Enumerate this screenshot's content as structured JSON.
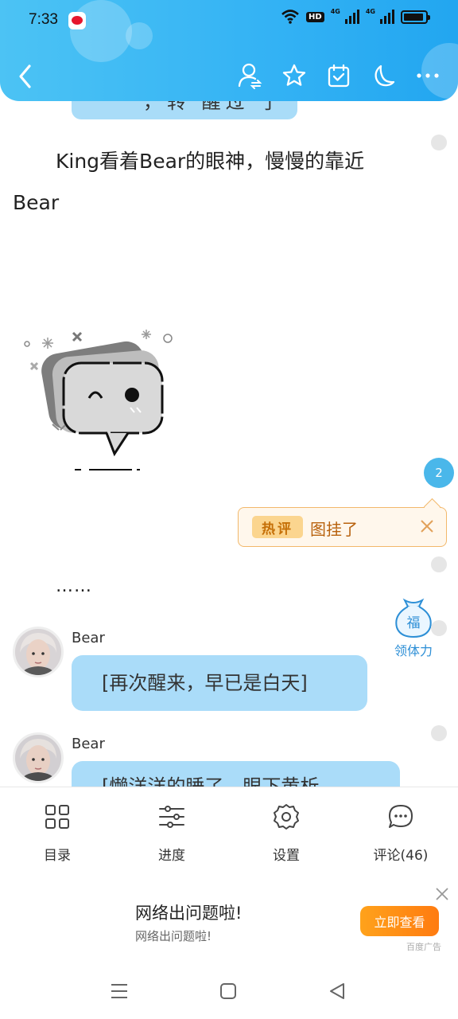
{
  "status_bar": {
    "time": "7:33",
    "hd_badge": "HD",
    "net_1": "4G",
    "net_2": "4G"
  },
  "header": {
    "icons": [
      "back-icon",
      "user-switch-icon",
      "star-icon",
      "calendar-check-icon",
      "moon-icon",
      "more-icon"
    ]
  },
  "content": {
    "top_bubble_fragment": "，转 醒过 了",
    "paragraph_1": "King看着Bear的眼神，慢慢的靠近Bear",
    "ellipsis": "……",
    "comment_badge": "2",
    "hot_comment": {
      "label": "热评",
      "text": "图挂了"
    },
    "fu": {
      "char": "福",
      "label": "领体力"
    },
    "messages": [
      {
        "speaker": "Bear",
        "text": "[再次醒来，早已是白天]"
      },
      {
        "speaker": "Bear",
        "text": "[懒洋洋的睡了，眼下黄析"
      }
    ]
  },
  "toolbar": {
    "items": [
      {
        "label": "目录",
        "icon": "grid-icon"
      },
      {
        "label": "进度",
        "icon": "sliders-icon"
      },
      {
        "label": "设置",
        "icon": "gear-icon"
      },
      {
        "label": "评论(46)",
        "icon": "comment-icon"
      }
    ]
  },
  "ad": {
    "title": "网络出问题啦!",
    "subtitle": "网络出问题啦!",
    "button": "立即查看",
    "tag": "百度广告"
  },
  "colors": {
    "header": "#33b2f4",
    "bubble": "#aadcf9",
    "accent_orange": "#ff8a14",
    "hot_border": "#f2b86b"
  }
}
